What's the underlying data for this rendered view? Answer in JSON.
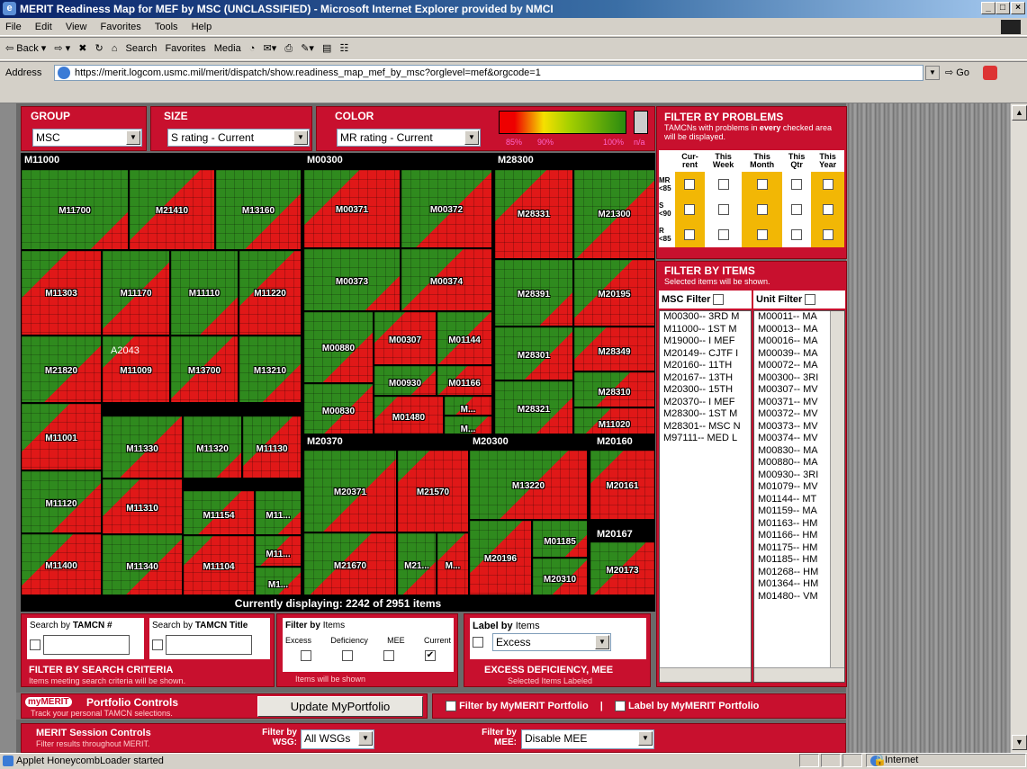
{
  "window": {
    "title": "MERIT Readiness Map for MEF by MSC (UNCLASSIFIED) - Microsoft Internet Explorer provided by NMCI",
    "min": "_",
    "max": "□",
    "close": "×"
  },
  "menu": [
    "File",
    "Edit",
    "View",
    "Favorites",
    "Tools",
    "Help"
  ],
  "toolbar": [
    "⇦ Back ▾",
    "⇨ ▾",
    "✖",
    "↻",
    "⌂",
    "Search",
    "Favorites",
    "Media",
    "◔",
    "✉▾",
    "⎙",
    "✎▾",
    "▤",
    "☷"
  ],
  "address": {
    "label": "Address",
    "url": "https://merit.logcom.usmc.mil/merit/dispatch/show.readiness_map_mef_by_msc?orglevel=mef&orgcode=1",
    "go": "Go"
  },
  "controls": {
    "group": {
      "label": "GROUP",
      "value": "MSC"
    },
    "size": {
      "label": "SIZE",
      "value": "S rating - Current"
    },
    "color": {
      "label": "COLOR",
      "value": "MR rating - Current"
    },
    "scale": [
      "85%",
      "90%",
      "100%",
      "n/a"
    ]
  },
  "sections": [
    "M11000",
    "M00300",
    "M28300",
    "M20370",
    "M20300",
    "M20160",
    "M20167"
  ],
  "cells": [
    {
      "id": "M11700",
      "l": 0,
      "t": 18,
      "w": 120,
      "h": 90
    },
    {
      "id": "M21410",
      "l": 120,
      "t": 18,
      "w": 96,
      "h": 90
    },
    {
      "id": "M13160",
      "l": 216,
      "t": 18,
      "w": 96,
      "h": 90
    },
    {
      "id": "M11303",
      "l": 0,
      "t": 108,
      "w": 90,
      "h": 95
    },
    {
      "id": "M11170",
      "l": 90,
      "t": 108,
      "w": 76,
      "h": 95
    },
    {
      "id": "M11110",
      "l": 166,
      "t": 108,
      "w": 76,
      "h": 95
    },
    {
      "id": "M11220",
      "l": 242,
      "t": 108,
      "w": 70,
      "h": 95
    },
    {
      "id": "M21820",
      "l": 0,
      "t": 203,
      "w": 90,
      "h": 75
    },
    {
      "id": "M11009",
      "l": 90,
      "t": 203,
      "w": 76,
      "h": 75
    },
    {
      "id": "M13700",
      "l": 166,
      "t": 203,
      "w": 76,
      "h": 75
    },
    {
      "id": "M13210",
      "l": 242,
      "t": 203,
      "w": 70,
      "h": 75
    },
    {
      "id": "M11001",
      "l": 0,
      "t": 278,
      "w": 90,
      "h": 75
    },
    {
      "id": "M11330",
      "l": 90,
      "t": 292,
      "w": 90,
      "h": 70
    },
    {
      "id": "M11320",
      "l": 180,
      "t": 292,
      "w": 66,
      "h": 70
    },
    {
      "id": "M11130",
      "l": 246,
      "t": 292,
      "w": 66,
      "h": 70
    },
    {
      "id": "M11120",
      "l": 0,
      "t": 353,
      "w": 90,
      "h": 70
    },
    {
      "id": "M11310",
      "l": 90,
      "t": 362,
      "w": 90,
      "h": 62
    },
    {
      "id": "M11154",
      "l": 180,
      "t": 375,
      "w": 80,
      "h": 50
    },
    {
      "id": "M11...",
      "l": 260,
      "t": 375,
      "w": 52,
      "h": 50
    },
    {
      "id": "M11400",
      "l": 0,
      "t": 423,
      "w": 90,
      "h": 69
    },
    {
      "id": "M11340",
      "l": 90,
      "t": 424,
      "w": 90,
      "h": 68
    },
    {
      "id": "M11104",
      "l": 180,
      "t": 425,
      "w": 80,
      "h": 67
    },
    {
      "id": "M11...",
      "l": 260,
      "t": 425,
      "w": 52,
      "h": 35
    },
    {
      "id": "M1...",
      "l": 260,
      "t": 460,
      "w": 52,
      "h": 32
    },
    {
      "id": "M00371",
      "l": 314,
      "t": 18,
      "w": 108,
      "h": 88
    },
    {
      "id": "M00372",
      "l": 422,
      "t": 18,
      "w": 102,
      "h": 88
    },
    {
      "id": "M00373",
      "l": 314,
      "t": 106,
      "w": 108,
      "h": 70
    },
    {
      "id": "M00374",
      "l": 422,
      "t": 106,
      "w": 102,
      "h": 70
    },
    {
      "id": "M00880",
      "l": 314,
      "t": 176,
      "w": 78,
      "h": 80
    },
    {
      "id": "M00307",
      "l": 392,
      "t": 176,
      "w": 70,
      "h": 60
    },
    {
      "id": "M01144",
      "l": 462,
      "t": 176,
      "w": 62,
      "h": 60
    },
    {
      "id": "M00930",
      "l": 392,
      "t": 236,
      "w": 70,
      "h": 34
    },
    {
      "id": "M01166",
      "l": 462,
      "t": 236,
      "w": 62,
      "h": 34
    },
    {
      "id": "M00830",
      "l": 314,
      "t": 256,
      "w": 78,
      "h": 57
    },
    {
      "id": "M01480",
      "l": 392,
      "t": 270,
      "w": 78,
      "h": 43
    },
    {
      "id": "M...",
      "l": 470,
      "t": 270,
      "w": 54,
      "h": 22
    },
    {
      "id": "M...",
      "l": 470,
      "t": 292,
      "w": 54,
      "h": 21
    },
    {
      "id": "M28331",
      "l": 526,
      "t": 18,
      "w": 88,
      "h": 100
    },
    {
      "id": "M21300",
      "l": 614,
      "t": 18,
      "w": 91,
      "h": 100
    },
    {
      "id": "M28391",
      "l": 526,
      "t": 118,
      "w": 88,
      "h": 75
    },
    {
      "id": "M20195",
      "l": 614,
      "t": 118,
      "w": 91,
      "h": 75
    },
    {
      "id": "M28301",
      "l": 526,
      "t": 193,
      "w": 88,
      "h": 60
    },
    {
      "id": "M28349",
      "l": 614,
      "t": 193,
      "w": 91,
      "h": 50
    },
    {
      "id": "M28310",
      "l": 614,
      "t": 243,
      "w": 91,
      "h": 40
    },
    {
      "id": "M28321",
      "l": 526,
      "t": 253,
      "w": 88,
      "h": 60
    },
    {
      "id": "M11020",
      "l": 614,
      "t": 283,
      "w": 91,
      "h": 30
    },
    {
      "id": "M20371",
      "l": 314,
      "t": 330,
      "w": 104,
      "h": 92
    },
    {
      "id": "M21570",
      "l": 418,
      "t": 330,
      "w": 80,
      "h": 92
    },
    {
      "id": "M21670",
      "l": 314,
      "t": 422,
      "w": 104,
      "h": 70
    },
    {
      "id": "M21...",
      "l": 418,
      "t": 422,
      "w": 44,
      "h": 70
    },
    {
      "id": "M...",
      "l": 462,
      "t": 422,
      "w": 36,
      "h": 70
    },
    {
      "id": "M13220",
      "l": 498,
      "t": 330,
      "w": 132,
      "h": 78
    },
    {
      "id": "M01185",
      "l": 568,
      "t": 408,
      "w": 62,
      "h": 42
    },
    {
      "id": "M20196",
      "l": 498,
      "t": 408,
      "w": 70,
      "h": 84
    },
    {
      "id": "M20310",
      "l": 568,
      "t": 450,
      "w": 62,
      "h": 42
    },
    {
      "id": "M20161",
      "l": 632,
      "t": 330,
      "w": 73,
      "h": 78
    },
    {
      "id": "M20173",
      "l": 632,
      "t": 432,
      "w": 73,
      "h": 60
    }
  ],
  "hover_label": "A2043",
  "displaying": "Currently displaying: 2242 of 2951 items",
  "search": {
    "tamcn_label": "Search by",
    "tamcn_bold": "TAMCN #",
    "title_label": "Search by",
    "title_bold": "TAMCN Title",
    "title": "FILTER BY SEARCH CRITERIA",
    "sub": "Items meeting search criteria will be shown."
  },
  "filter_items": {
    "title": "Filter by",
    "title2": "Items",
    "cols": [
      "Excess",
      "Deficiency",
      "MEE",
      "Current"
    ],
    "footer": "Items will be shown"
  },
  "label_items": {
    "title": "Label by",
    "title2": "Items",
    "value": "Excess",
    "footer": "EXCESS DEFICIENCY, MEE",
    "sub": "Selected Items Labeled"
  },
  "problems": {
    "title": "FILTER BY PROBLEMS",
    "sub1": "TAMCNs with problems in",
    "sub_bold": "every",
    "sub2": "checked area will be displayed.",
    "cols": [
      "Cur-rent",
      "This Week",
      "This Month",
      "This Qtr",
      "This Year"
    ],
    "rows": [
      "MR <85",
      "S <90",
      "R <85"
    ]
  },
  "items": {
    "title": "FILTER BY ITEMS",
    "sub": "Selected items will be shown.",
    "msc_label": "MSC Filter",
    "unit_label": "Unit Filter",
    "msc": [
      "M00300-- 3RD M",
      "M11000-- 1ST M",
      "M19000-- I MEF",
      "M20149-- CJTF I",
      "M20160-- 11TH",
      "M20167-- 13TH",
      "M20300-- 15TH",
      "M20370-- I MEF",
      "M28300-- 1ST M",
      "M28301-- MSC N",
      "M97111-- MED L"
    ],
    "unit": [
      "M00011-- MA",
      "M00013-- MA",
      "M00016-- MA",
      "M00039-- MA",
      "M00072-- MA",
      "M00300-- 3RI",
      "M00307-- MV",
      "M00371-- MV",
      "M00372-- MV",
      "M00373-- MV",
      "M00374-- MV",
      "M00830-- MA",
      "M00880-- MA",
      "M00930-- 3RI",
      "M01079-- MV",
      "M01144-- MT",
      "M01159-- MA",
      "M01163-- HM",
      "M01166-- HM",
      "M01175-- HM",
      "M01185-- HM",
      "M01268-- HM",
      "M01364-- HM",
      "M01480-- VM"
    ]
  },
  "portfolio": {
    "logo": "myMERIT",
    "title": "Portfolio Controls",
    "sub": "Track your personal TAMCN selections.",
    "update": "Update MyPortfolio",
    "filter": "Filter by MyMERIT Portfolio",
    "label": "Label by MyMERIT Portfolio",
    "sep": "|"
  },
  "session": {
    "title": "MERIT Session Controls",
    "sub": "Filter results throughout MERIT.",
    "wsg_label": "Filter by WSG:",
    "wsg_value": "All WSGs",
    "mee_label": "Filter by MEE:",
    "mee_value": "Disable MEE"
  },
  "status": {
    "text": "Applet HoneycombLoader started",
    "zone": "Internet"
  }
}
